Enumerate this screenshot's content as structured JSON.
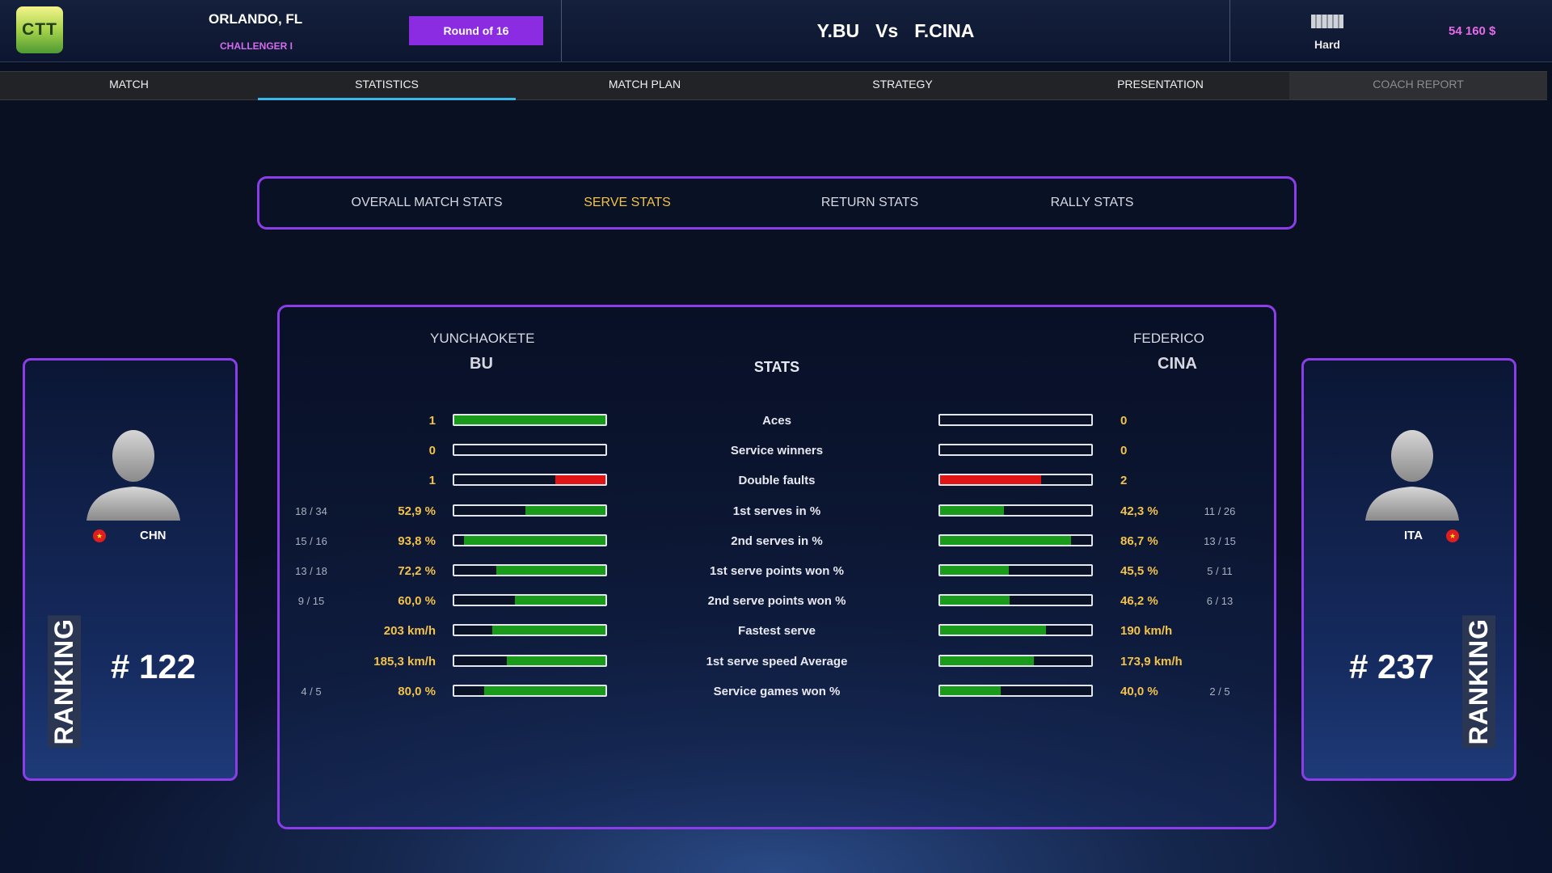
{
  "header": {
    "logo_text": "CTT",
    "city": "ORLANDO, FL",
    "tournament_level": "CHALLENGER I",
    "round": "Round of 16",
    "player_left_short": "Y.BU",
    "versus": "Vs",
    "player_right_short": "F.CINA",
    "surface": "Hard",
    "money": "54 160 $"
  },
  "tabs": [
    {
      "label": "MATCH",
      "active": false,
      "disabled": false
    },
    {
      "label": "STATISTICS",
      "active": true,
      "disabled": false
    },
    {
      "label": "MATCH PLAN",
      "active": false,
      "disabled": false
    },
    {
      "label": "STRATEGY",
      "active": false,
      "disabled": false
    },
    {
      "label": "PRESENTATION",
      "active": false,
      "disabled": false
    },
    {
      "label": "COACH REPORT",
      "active": false,
      "disabled": true
    }
  ],
  "subtabs": [
    {
      "label": "OVERALL MATCH STATS",
      "active": false
    },
    {
      "label": "SERVE STATS",
      "active": true
    },
    {
      "label": "RETURN STATS",
      "active": false
    },
    {
      "label": "RALLY STATS",
      "active": false
    }
  ],
  "left_player": {
    "first_name": "YUNCHAOKETE",
    "last_name": "BU",
    "country": "CHN",
    "ranking_label": "RANKING",
    "ranking": "# 122"
  },
  "right_player": {
    "first_name": "FEDERICO",
    "last_name": "CINA",
    "country": "ITA",
    "ranking_label": "RANKING",
    "ranking": "# 237"
  },
  "stats_header": "STATS",
  "colors": {
    "green": "#1a9a1a",
    "red": "#e01414",
    "accent": "#8c3dea",
    "value": "#f2c24a"
  },
  "stats": [
    {
      "label": "Aces",
      "left_frac": "",
      "left_value": "1",
      "left_fill": 1.0,
      "left_color": "green",
      "right_frac": "",
      "right_value": "0",
      "right_fill": 0.0,
      "right_color": "green"
    },
    {
      "label": "Service winners",
      "left_frac": "",
      "left_value": "0",
      "left_fill": 0.0,
      "left_color": "green",
      "right_frac": "",
      "right_value": "0",
      "right_fill": 0.0,
      "right_color": "green"
    },
    {
      "label": "Double faults",
      "left_frac": "",
      "left_value": "1",
      "left_fill": 0.33,
      "left_color": "red",
      "right_frac": "",
      "right_value": "2",
      "right_fill": 0.67,
      "right_color": "red"
    },
    {
      "label": "1st serves in %",
      "left_frac": "18 / 34",
      "left_value": "52,9 %",
      "left_fill": 0.529,
      "left_color": "green",
      "right_frac": "11 / 26",
      "right_value": "42,3 %",
      "right_fill": 0.423,
      "right_color": "green"
    },
    {
      "label": "2nd serves in %",
      "left_frac": "15 / 16",
      "left_value": "93,8 %",
      "left_fill": 0.938,
      "left_color": "green",
      "right_frac": "13 / 15",
      "right_value": "86,7 %",
      "right_fill": 0.867,
      "right_color": "green"
    },
    {
      "label": "1st serve points won %",
      "left_frac": "13 / 18",
      "left_value": "72,2 %",
      "left_fill": 0.722,
      "left_color": "green",
      "right_frac": "5 / 11",
      "right_value": "45,5 %",
      "right_fill": 0.455,
      "right_color": "green"
    },
    {
      "label": "2nd serve points won %",
      "left_frac": "9 / 15",
      "left_value": "60,0 %",
      "left_fill": 0.6,
      "left_color": "green",
      "right_frac": "6 / 13",
      "right_value": "46,2 %",
      "right_fill": 0.462,
      "right_color": "green"
    },
    {
      "label": "Fastest serve",
      "left_frac": "",
      "left_value": "203 km/h",
      "left_fill": 0.75,
      "left_color": "green",
      "right_frac": "",
      "right_value": "190 km/h",
      "right_fill": 0.7,
      "right_color": "green"
    },
    {
      "label": "1st serve speed Average",
      "left_frac": "",
      "left_value": "185,3 km/h",
      "left_fill": 0.65,
      "left_color": "green",
      "right_frac": "",
      "right_value": "173,9 km/h",
      "right_fill": 0.62,
      "right_color": "green"
    },
    {
      "label": "Service games won %",
      "left_frac": "4 / 5",
      "left_value": "80,0 %",
      "left_fill": 0.8,
      "left_color": "green",
      "right_frac": "2 / 5",
      "right_value": "40,0 %",
      "right_fill": 0.4,
      "right_color": "green"
    }
  ]
}
